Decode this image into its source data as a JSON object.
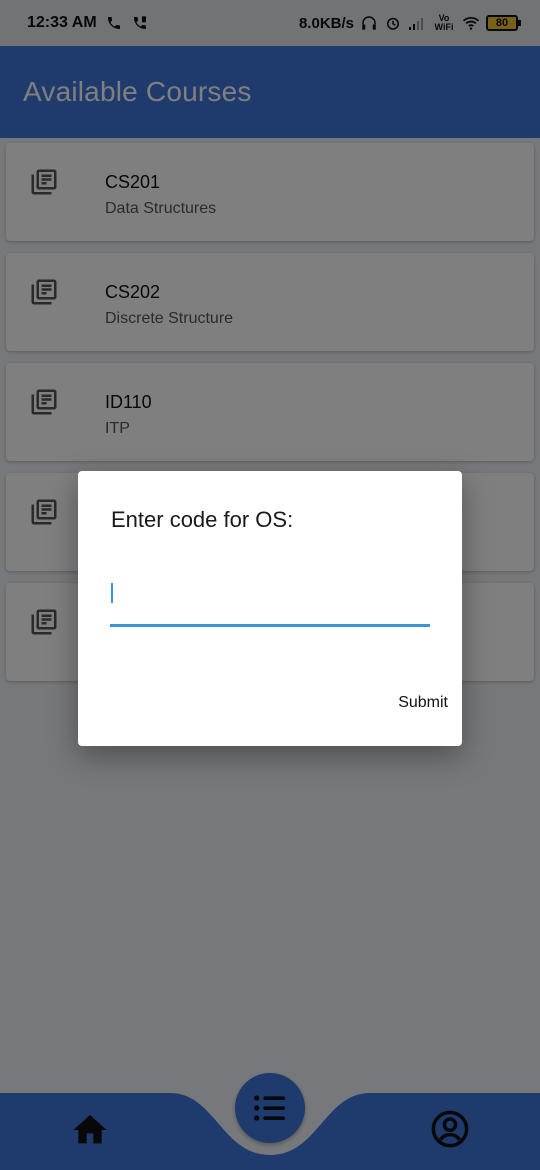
{
  "status_bar": {
    "time": "12:33 AM",
    "speed": "8.0KB/s",
    "vowifi": "Vo WiFi",
    "battery": "80",
    "icons": [
      "phone-icon",
      "phone-signal-icon",
      "headphones-icon",
      "alarm-icon",
      "signal-icon",
      "wifi-icon"
    ]
  },
  "app_bar": {
    "title": "Available Courses"
  },
  "courses": [
    {
      "code": "CS201",
      "name": "Data Structures"
    },
    {
      "code": "CS202",
      "name": "Discrete Structure"
    },
    {
      "code": "ID110",
      "name": "ITP"
    },
    {
      "code": "",
      "name": ""
    },
    {
      "code": "",
      "name": ""
    }
  ],
  "dialog": {
    "title": "Enter code for OS:",
    "input_value": "",
    "submit_label": "Submit"
  },
  "bottom_nav": {
    "items": [
      "home-icon",
      "list-icon",
      "profile-icon"
    ]
  },
  "colors": {
    "primary": "#3f74d9",
    "input_accent": "#3a93dc"
  }
}
